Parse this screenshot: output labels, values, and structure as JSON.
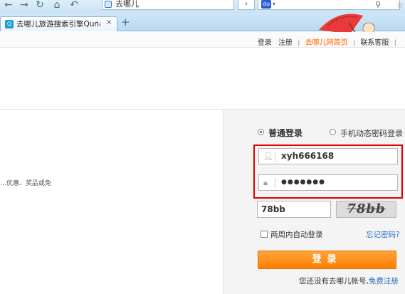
{
  "browser": {
    "address_text": "去哪儿",
    "tab_title": "去哪儿旅游搜索引擎Qunar",
    "tab_close": "×",
    "new_tab": "+",
    "go_label": "›"
  },
  "header": {
    "links": [
      "登录",
      "注册",
      "去哪儿网首页",
      "联系客服"
    ],
    "separator": "|"
  },
  "promo_text": "…优惠、奖品或免",
  "login": {
    "mode_normal": "普通登录",
    "mode_dynamic": "手机动态密码登录",
    "username_value": "xyh666168",
    "password_value": "●●●●●●●",
    "captcha_value": "78bb",
    "captcha_image_text": "78bb",
    "remember_label": "两周内自动登录",
    "forgot_label": "忘记密码?",
    "submit_label": "登录",
    "no_account_text": "您还没有去哪儿帐号,",
    "register_label": "免费注册"
  },
  "colors": {
    "accent_orange": "#ff7f00",
    "link_blue": "#2f6fbf",
    "highlight_red": "#e00000"
  }
}
